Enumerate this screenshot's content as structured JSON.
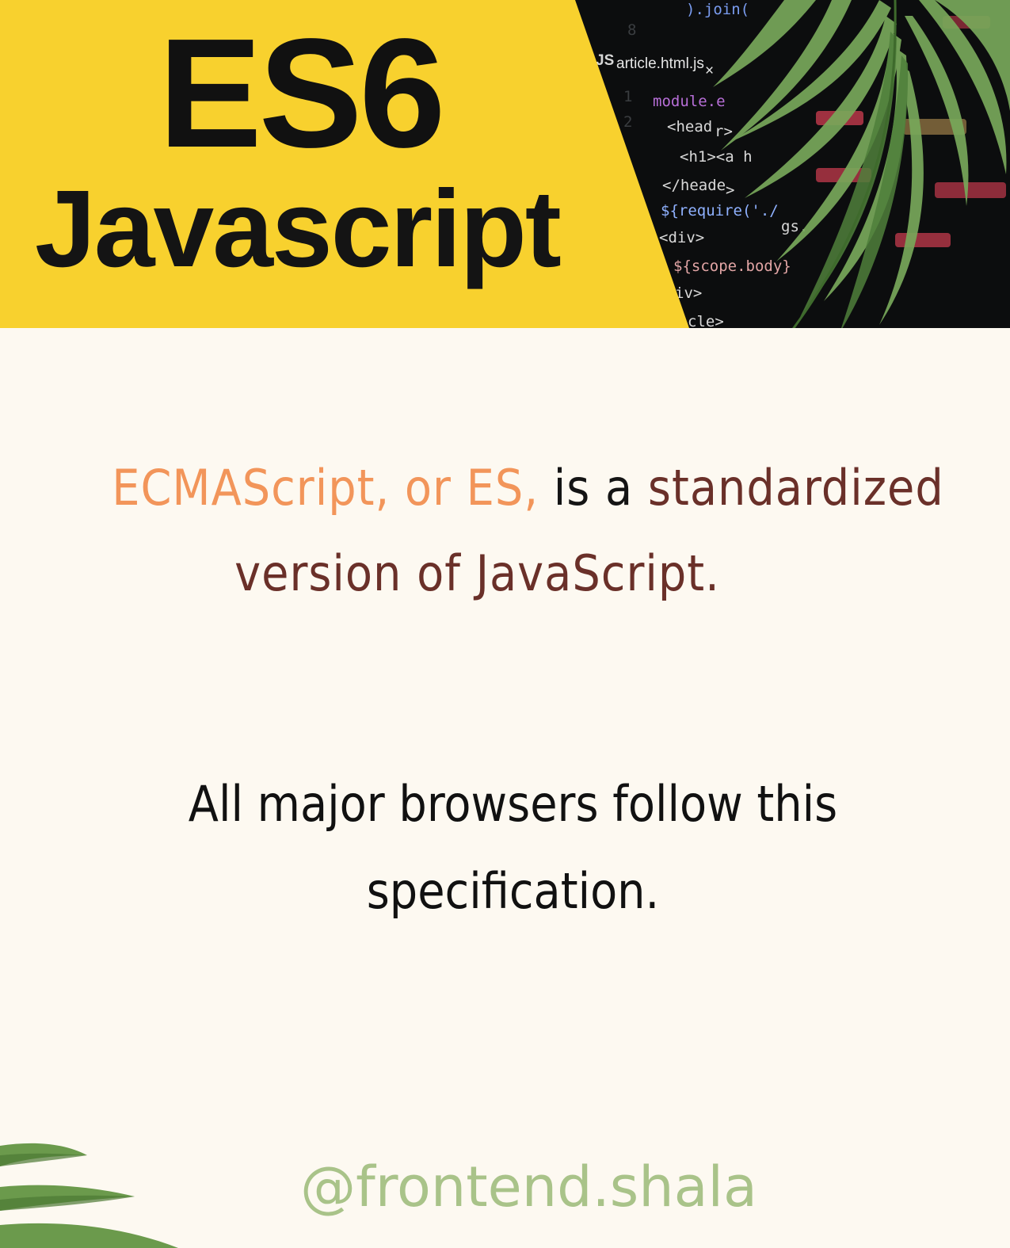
{
  "banner": {
    "title": "ES6",
    "subtitle": "Javascript",
    "file_tab": "article.html.js",
    "file_tab_icon": "JS",
    "close_glyph": "×",
    "code_lines": [
      ").join(",
      "module.e",
      "<head",
      "r>",
      "<h1><a h",
      "</heade",
      ">",
      "${require('./",
      "gs.",
      "<div>",
      "${scope.body}",
      "iv>",
      "cle>"
    ],
    "colors": {
      "yellow": "#f8d12e",
      "dark": "#0c0d0e",
      "leaf": "#6f9e4e"
    }
  },
  "paragraph_1": {
    "accent_text": "ECMAScript, or ES,",
    "plain_text": "is a",
    "brown_text_1": "standardized",
    "brown_text_2": "version of JavaScript."
  },
  "paragraph_2": {
    "line_1": "All major browsers follow this",
    "line_2": "specification."
  },
  "handle": "@frontend.shala",
  "colors": {
    "background": "#fdf9f1",
    "accent_orange": "#f2955a",
    "brown": "#6a3029",
    "handle_green": "#a9c389"
  }
}
